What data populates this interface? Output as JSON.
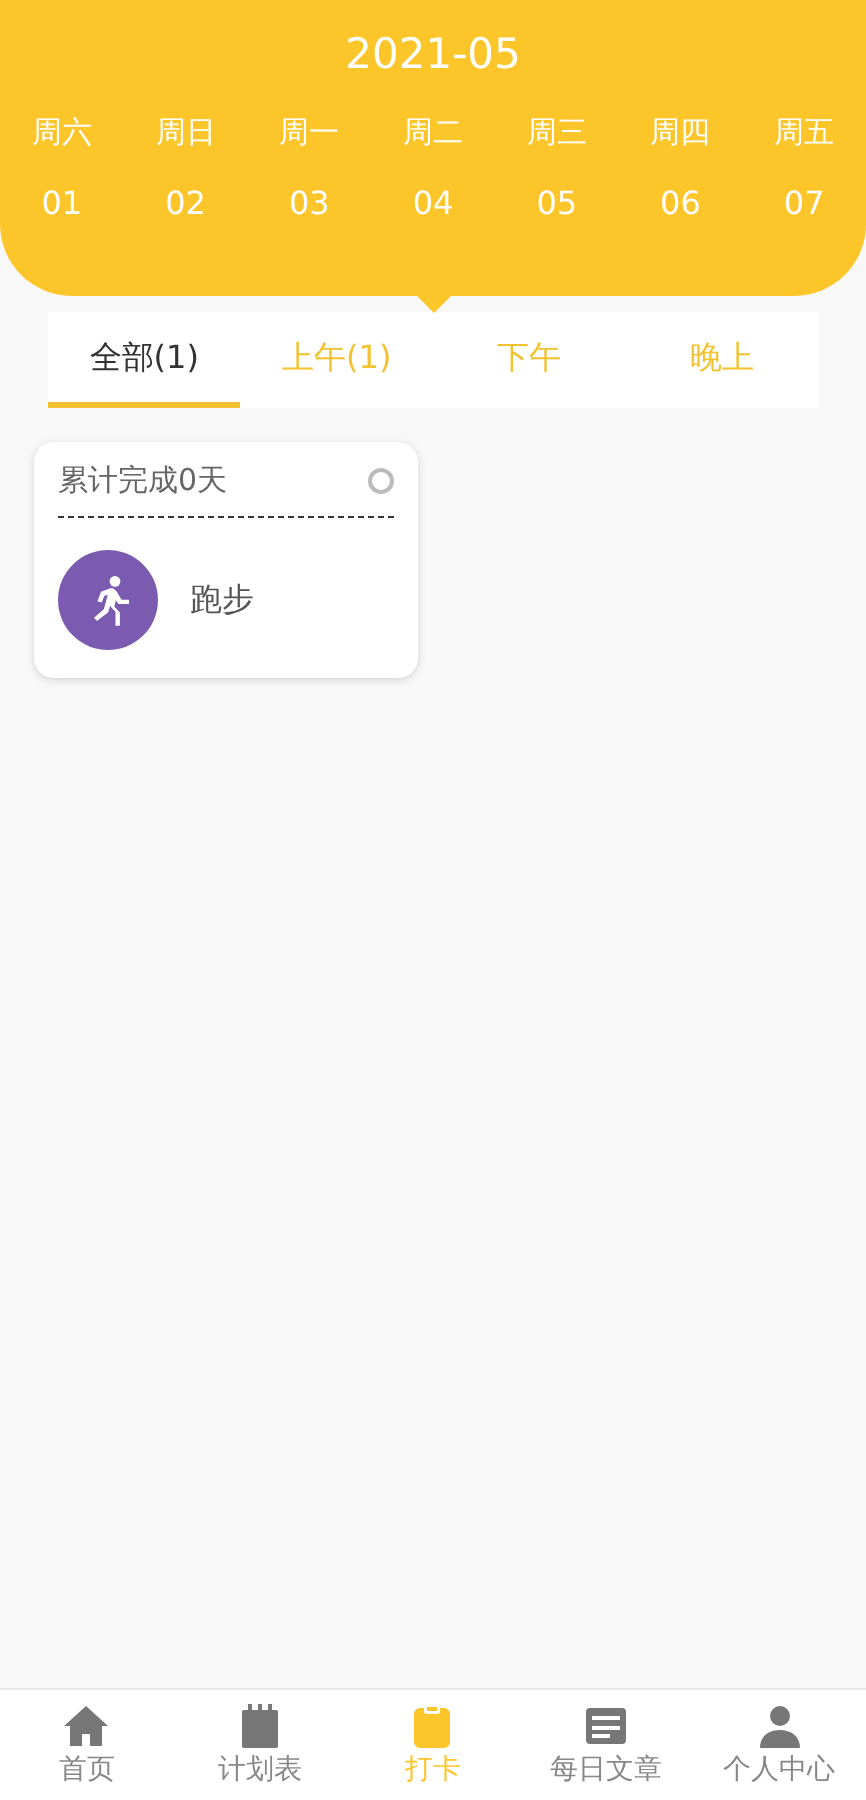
{
  "header": {
    "title": "2021-05"
  },
  "days": [
    {
      "weekday": "周六",
      "date": "01",
      "selected": false
    },
    {
      "weekday": "周日",
      "date": "02",
      "selected": false
    },
    {
      "weekday": "周一",
      "date": "03",
      "selected": false
    },
    {
      "weekday": "周二",
      "date": "04",
      "selected": true
    },
    {
      "weekday": "周三",
      "date": "05",
      "selected": false
    },
    {
      "weekday": "周四",
      "date": "06",
      "selected": false
    },
    {
      "weekday": "周五",
      "date": "07",
      "selected": false
    }
  ],
  "tabs": [
    {
      "label": "全部(1)",
      "selected": true
    },
    {
      "label": "上午(1)",
      "selected": false
    },
    {
      "label": "下午",
      "selected": false
    },
    {
      "label": "晚上",
      "selected": false
    }
  ],
  "habits": [
    {
      "summary": "累计完成0天",
      "name": "跑步",
      "checked": false,
      "color": "#7b5bb0"
    }
  ],
  "nav": [
    {
      "label": "首页",
      "selected": false
    },
    {
      "label": "计划表",
      "selected": false
    },
    {
      "label": "打卡",
      "selected": true
    },
    {
      "label": "每日文章",
      "selected": false
    },
    {
      "label": "个人中心",
      "selected": false
    }
  ]
}
